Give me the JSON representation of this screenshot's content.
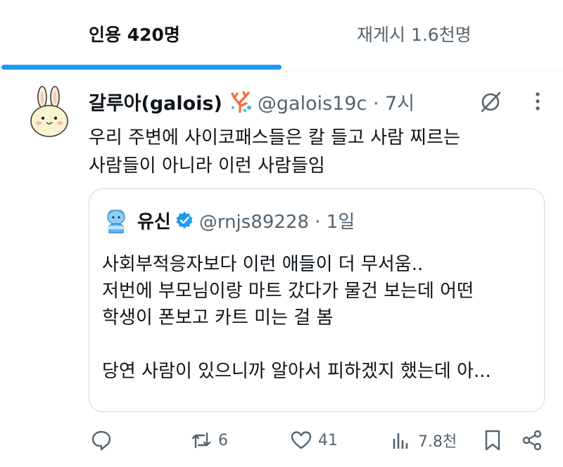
{
  "tabs": {
    "quotes_label": "인용 420명",
    "reposts_label": "재게시 1.6천명"
  },
  "post": {
    "display_name": "갈루아(galois)",
    "handle_time": "@galois19c · 7시",
    "lines": [
      "우리 주변에 사이코패스들은 칼 들고 사람 찌르는",
      "사람들이 아니라 이런 사람들임"
    ]
  },
  "quoted": {
    "display_name": "유신",
    "handle_time": "@rnjs89228 · 1일",
    "lines": [
      "사회부적응자보다 이런 애들이 더 무서움..",
      "저번에 부모님이랑 마트 갔다가 물건 보는데 어떤",
      "학생이 폰보고 카트 미는 걸 봄",
      "당연 사람이 있으니까 알아서 피하겠지 했는데 아..."
    ]
  },
  "actions": {
    "replies": "",
    "reposts": "6",
    "likes": "41",
    "views": "7.8천"
  },
  "colors": {
    "accent": "#1d9bf0",
    "secondary_text": "#536471",
    "border": "#cfd9de"
  },
  "icons": [
    "reply-icon",
    "repost-icon",
    "like-icon",
    "views-icon",
    "bookmark-icon",
    "share-icon",
    "grok-icon",
    "more-icon",
    "verified-badge-icon",
    "coral-emoji-icon"
  ]
}
